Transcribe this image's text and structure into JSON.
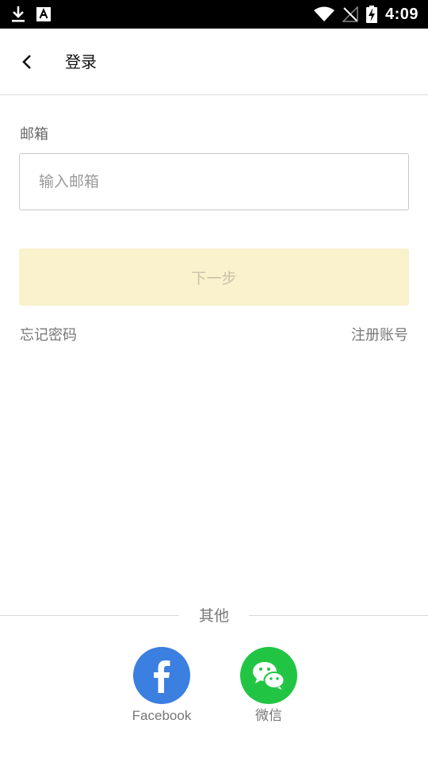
{
  "status_bar": {
    "time": "4:09"
  },
  "header": {
    "title": "登录"
  },
  "form": {
    "email_label": "邮箱",
    "email_placeholder": "输入邮箱",
    "email_value": "",
    "next_label": "下一步"
  },
  "links": {
    "forgot_password": "忘记密码",
    "register": "注册账号"
  },
  "other_login": {
    "divider_label": "其他",
    "providers": [
      {
        "label": "Facebook",
        "icon": "facebook-icon",
        "color": "#3b7fe0"
      },
      {
        "label": "微信",
        "icon": "wechat-icon",
        "color": "#22c543"
      }
    ]
  },
  "colors": {
    "next_button_bg": "#faf1cd",
    "next_button_text": "#c9c2a9"
  }
}
